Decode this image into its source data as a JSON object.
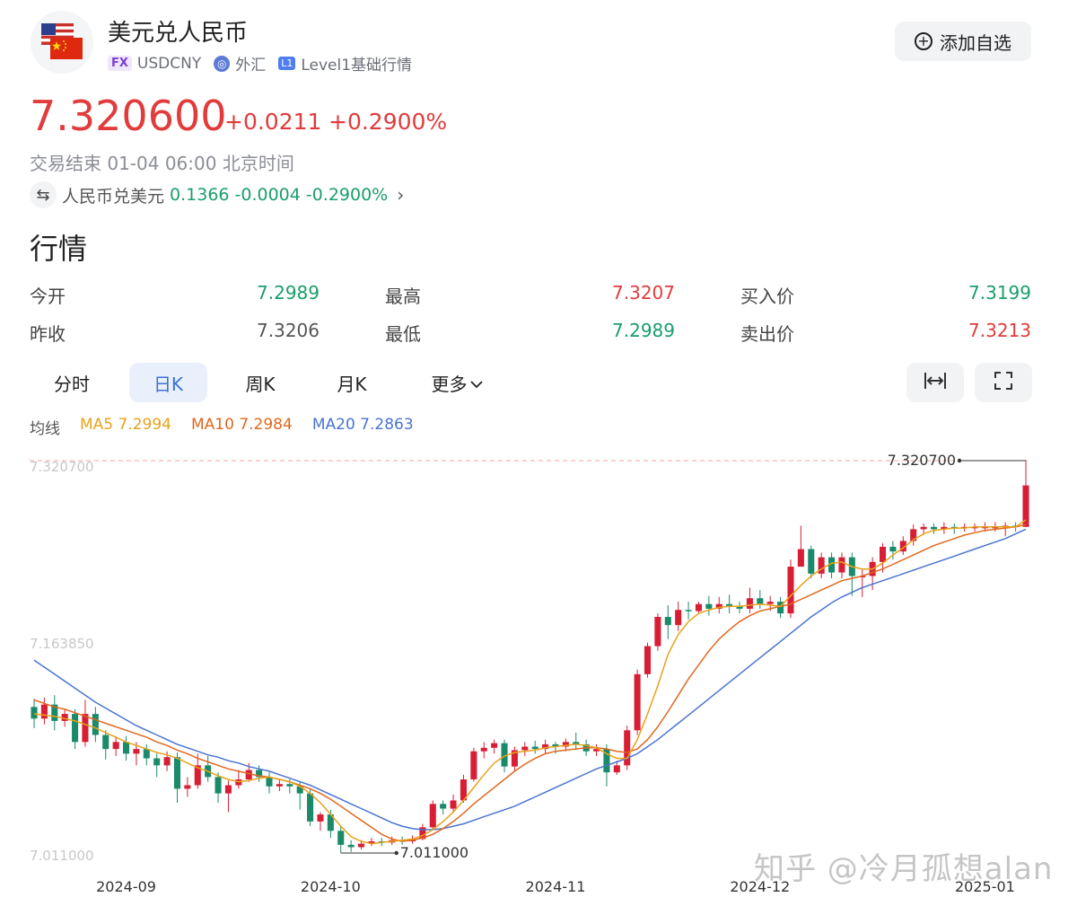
{
  "header": {
    "title": "美元兑人民币",
    "tag_fx": "FX",
    "symbol": "USDCNY",
    "market": "外汇",
    "tag_l1": "L1",
    "level": "Level1基础行情",
    "watch_label": "添加自选"
  },
  "quote": {
    "price": "7.320600",
    "change": "+0.0211",
    "change_pct": "+0.2900%",
    "session": "交易结束 01-04 06:00 北京时间",
    "inverse_label": "人民币兑美元",
    "inverse_price": "0.1366",
    "inverse_change": "-0.0004",
    "inverse_pct": "-0.2900%"
  },
  "section_title": "行情",
  "stats": {
    "open_label": "今开",
    "open": "7.2989",
    "high_label": "最高",
    "high": "7.3207",
    "bid_label": "买入价",
    "bid": "7.3199",
    "prev_close_label": "昨收",
    "prev_close": "7.3206",
    "low_label": "最低",
    "low": "7.2989",
    "ask_label": "卖出价",
    "ask": "7.3213"
  },
  "tabs": [
    "分时",
    "日K",
    "周K",
    "月K",
    "更多"
  ],
  "active_tab": "日K",
  "ma": {
    "label": "均线",
    "ma5": "MA5 7.2994",
    "ma10": "MA10 7.2984",
    "ma20": "MA20 7.2863"
  },
  "colors": {
    "up": "#d81e35",
    "down": "#1a8a6a",
    "ma5": "#e8a21a",
    "ma10": "#e0681f",
    "ma20": "#4a74d0",
    "accent": "#3a6fd8"
  },
  "watermark": "知乎 @冷月孤想alan",
  "chart_data": {
    "type": "candlestick",
    "y_range": [
      7.011,
      7.3207
    ],
    "axis_top_label": "7.320700",
    "axis_mid_label": "7.163850",
    "axis_bottom_label": "7.011000",
    "high_marker_label": "7.320700",
    "low_marker_label": "7.011000",
    "x_ticks": [
      "2024-09",
      "2024-10",
      "2024-11",
      "2024-12",
      "2025-01"
    ],
    "tick_positions": [
      9,
      29,
      51,
      71,
      93
    ],
    "candles": [
      [
        7.11,
        7.1,
        7.117,
        7.092
      ],
      [
        7.1,
        7.112,
        7.118,
        7.095
      ],
      [
        7.112,
        7.098,
        7.12,
        7.09
      ],
      [
        7.098,
        7.104,
        7.108,
        7.093
      ],
      [
        7.104,
        7.08,
        7.108,
        7.074
      ],
      [
        7.08,
        7.104,
        7.116,
        7.076
      ],
      [
        7.104,
        7.086,
        7.11,
        7.08
      ],
      [
        7.086,
        7.074,
        7.09,
        7.065
      ],
      [
        7.074,
        7.08,
        7.085,
        7.068
      ],
      [
        7.08,
        7.07,
        7.085,
        7.064
      ],
      [
        7.07,
        7.074,
        7.08,
        7.06
      ],
      [
        7.074,
        7.066,
        7.078,
        7.06
      ],
      [
        7.066,
        7.06,
        7.07,
        7.05
      ],
      [
        7.06,
        7.067,
        7.072,
        7.055
      ],
      [
        7.067,
        7.04,
        7.071,
        7.028
      ],
      [
        7.04,
        7.043,
        7.05,
        7.033
      ],
      [
        7.043,
        7.06,
        7.07,
        7.04
      ],
      [
        7.06,
        7.05,
        7.068,
        7.046
      ],
      [
        7.05,
        7.036,
        7.054,
        7.028
      ],
      [
        7.036,
        7.043,
        7.047,
        7.02
      ],
      [
        7.043,
        7.048,
        7.056,
        7.04
      ],
      [
        7.048,
        7.056,
        7.062,
        7.046
      ],
      [
        7.056,
        7.05,
        7.06,
        7.046
      ],
      [
        7.05,
        7.042,
        7.054,
        7.036
      ],
      [
        7.042,
        7.044,
        7.048,
        7.038
      ],
      [
        7.044,
        7.042,
        7.048,
        7.036
      ],
      [
        7.042,
        7.036,
        7.046,
        7.022
      ],
      [
        7.036,
        7.012,
        7.04,
        7.008
      ],
      [
        7.012,
        7.018,
        7.02,
        7.004
      ],
      [
        7.018,
        7.004,
        7.022,
        6.998
      ],
      [
        7.004,
        6.992,
        7.008,
        6.985
      ],
      [
        6.992,
        6.99,
        6.996,
        6.986
      ],
      [
        6.99,
        6.993,
        6.996,
        6.988
      ],
      [
        6.993,
        6.995,
        6.998,
        6.991
      ],
      [
        6.995,
        6.994,
        6.998,
        6.991
      ],
      [
        6.994,
        6.996,
        6.999,
        6.992
      ],
      [
        6.996,
        6.995,
        6.999,
        6.992
      ],
      [
        6.995,
        6.997,
        7.0,
        6.993
      ],
      [
        6.997,
        7.007,
        7.01,
        6.996
      ],
      [
        7.007,
        7.027,
        7.03,
        7.005
      ],
      [
        7.027,
        7.023,
        7.03,
        7.018
      ],
      [
        7.023,
        7.03,
        7.035,
        7.02
      ],
      [
        7.03,
        7.048,
        7.052,
        7.028
      ],
      [
        7.048,
        7.072,
        7.075,
        7.046
      ],
      [
        7.072,
        7.075,
        7.08,
        7.066
      ],
      [
        7.075,
        7.079,
        7.082,
        7.07
      ],
      [
        7.079,
        7.059,
        7.082,
        7.054
      ],
      [
        7.059,
        7.073,
        7.076,
        7.055
      ],
      [
        7.073,
        7.076,
        7.08,
        7.068
      ],
      [
        7.076,
        7.074,
        7.081,
        7.07
      ],
      [
        7.074,
        7.078,
        7.082,
        7.07
      ],
      [
        7.078,
        7.076,
        7.08,
        7.07
      ],
      [
        7.076,
        7.08,
        7.083,
        7.072
      ],
      [
        7.08,
        7.078,
        7.088,
        7.074
      ],
      [
        7.078,
        7.072,
        7.082,
        7.068
      ],
      [
        7.072,
        7.074,
        7.078,
        7.068
      ],
      [
        7.074,
        7.054,
        7.078,
        7.042
      ],
      [
        7.054,
        7.06,
        7.064,
        7.052
      ],
      [
        7.06,
        7.09,
        7.094,
        7.056
      ],
      [
        7.09,
        7.138,
        7.142,
        7.086
      ],
      [
        7.138,
        7.162,
        7.165,
        7.135
      ],
      [
        7.162,
        7.187,
        7.19,
        7.158
      ],
      [
        7.187,
        7.18,
        7.197,
        7.168
      ],
      [
        7.18,
        7.193,
        7.2,
        7.175
      ],
      [
        7.193,
        7.192,
        7.2,
        7.185
      ],
      [
        7.192,
        7.198,
        7.2,
        7.19
      ],
      [
        7.198,
        7.194,
        7.205,
        7.188
      ],
      [
        7.194,
        7.198,
        7.204,
        7.19
      ],
      [
        7.198,
        7.196,
        7.206,
        7.19
      ],
      [
        7.196,
        7.194,
        7.2,
        7.19
      ],
      [
        7.194,
        7.203,
        7.212,
        7.19
      ],
      [
        7.203,
        7.198,
        7.21,
        7.194
      ],
      [
        7.198,
        7.2,
        7.205,
        7.192
      ],
      [
        7.2,
        7.19,
        7.204,
        7.186
      ],
      [
        7.19,
        7.23,
        7.236,
        7.186
      ],
      [
        7.23,
        7.245,
        7.265,
        7.236
      ],
      [
        7.245,
        7.224,
        7.248,
        7.22
      ],
      [
        7.224,
        7.238,
        7.242,
        7.22
      ],
      [
        7.238,
        7.225,
        7.242,
        7.22
      ],
      [
        7.225,
        7.238,
        7.242,
        7.22
      ],
      [
        7.238,
        7.222,
        7.242,
        7.205
      ],
      [
        7.222,
        7.222,
        7.228,
        7.204
      ],
      [
        7.222,
        7.234,
        7.238,
        7.21
      ],
      [
        7.234,
        7.247,
        7.25,
        7.225
      ],
      [
        7.247,
        7.243,
        7.252,
        7.236
      ],
      [
        7.243,
        7.252,
        7.256,
        7.24
      ],
      [
        7.252,
        7.262,
        7.266,
        7.248
      ],
      [
        7.262,
        7.264,
        7.267,
        7.258
      ],
      [
        7.264,
        7.262,
        7.267,
        7.258
      ],
      [
        7.262,
        7.264,
        7.268,
        7.258
      ],
      [
        7.264,
        7.263,
        7.267,
        7.258
      ],
      [
        7.263,
        7.264,
        7.267,
        7.26
      ],
      [
        7.264,
        7.264,
        7.267,
        7.26
      ],
      [
        7.264,
        7.264,
        7.268,
        7.26
      ],
      [
        7.264,
        7.264,
        7.268,
        7.26
      ],
      [
        7.264,
        7.265,
        7.268,
        7.256
      ],
      [
        7.265,
        7.264,
        7.268,
        7.26
      ],
      [
        7.264,
        7.2995,
        7.3207,
        7.2989
      ]
    ],
    "ma5": [
      7.104,
      7.103,
      7.102,
      7.1,
      7.098,
      7.095,
      7.092,
      7.088,
      7.084,
      7.08,
      7.077,
      7.074,
      7.071,
      7.069,
      7.066,
      7.062,
      7.058,
      7.055,
      7.051,
      7.048,
      7.046,
      7.047,
      7.049,
      7.05,
      7.048,
      7.046,
      7.042,
      7.036,
      7.028,
      7.018,
      7.008,
      6.999,
      6.995,
      6.993,
      6.994,
      6.995,
      6.996,
      6.997,
      7.0,
      7.005,
      7.012,
      7.02,
      7.03,
      7.041,
      7.052,
      7.062,
      7.068,
      7.071,
      7.072,
      7.073,
      7.075,
      7.076,
      7.077,
      7.078,
      7.077,
      7.075,
      7.07,
      7.066,
      7.066,
      7.082,
      7.104,
      7.128,
      7.155,
      7.172,
      7.183,
      7.19,
      7.193,
      7.195,
      7.196,
      7.196,
      7.197,
      7.198,
      7.197,
      7.196,
      7.205,
      7.214,
      7.222,
      7.228,
      7.233,
      7.234,
      7.23,
      7.228,
      7.228,
      7.233,
      7.24,
      7.246,
      7.253,
      7.258,
      7.261,
      7.262,
      7.263,
      7.263,
      7.264,
      7.264,
      7.264,
      7.264,
      7.264,
      7.27
    ],
    "ma10": [
      7.116,
      7.113,
      7.11,
      7.108,
      7.105,
      7.102,
      7.099,
      7.096,
      7.093,
      7.09,
      7.087,
      7.084,
      7.08,
      7.077,
      7.073,
      7.07,
      7.066,
      7.063,
      7.06,
      7.057,
      7.055,
      7.053,
      7.051,
      7.05,
      7.048,
      7.046,
      7.043,
      7.04,
      7.036,
      7.031,
      7.025,
      7.019,
      7.013,
      7.007,
      7.001,
      6.997,
      6.995,
      6.996,
      6.998,
      7.001,
      7.006,
      7.012,
      7.019,
      7.027,
      7.034,
      7.041,
      7.048,
      7.055,
      7.061,
      7.066,
      7.07,
      7.072,
      7.073,
      7.074,
      7.075,
      7.075,
      7.074,
      7.072,
      7.071,
      7.074,
      7.082,
      7.093,
      7.106,
      7.12,
      7.134,
      7.146,
      7.158,
      7.168,
      7.176,
      7.183,
      7.188,
      7.192,
      7.194,
      7.196,
      7.198,
      7.202,
      7.206,
      7.21,
      7.214,
      7.218,
      7.22,
      7.222,
      7.225,
      7.228,
      7.232,
      7.236,
      7.24,
      7.244,
      7.248,
      7.251,
      7.254,
      7.257,
      7.259,
      7.261,
      7.262,
      7.263,
      7.264,
      7.266
    ],
    "ma20": [
      7.15,
      7.144,
      7.138,
      7.132,
      7.126,
      7.12,
      7.114,
      7.109,
      7.104,
      7.099,
      7.094,
      7.09,
      7.086,
      7.082,
      7.078,
      7.075,
      7.072,
      7.069,
      7.067,
      7.064,
      7.062,
      7.059,
      7.057,
      7.055,
      7.052,
      7.049,
      7.046,
      7.043,
      7.039,
      7.035,
      7.031,
      7.027,
      7.023,
      7.019,
      7.015,
      7.011,
      7.008,
      7.006,
      7.005,
      7.005,
      7.006,
      7.008,
      7.01,
      7.013,
      7.016,
      7.019,
      7.022,
      7.025,
      7.029,
      7.033,
      7.037,
      7.041,
      7.045,
      7.049,
      7.053,
      7.057,
      7.06,
      7.063,
      7.066,
      7.07,
      7.076,
      7.082,
      7.089,
      7.096,
      7.103,
      7.11,
      7.117,
      7.124,
      7.131,
      7.138,
      7.145,
      7.152,
      7.159,
      7.166,
      7.173,
      7.18,
      7.187,
      7.193,
      7.199,
      7.204,
      7.208,
      7.212,
      7.215,
      7.218,
      7.221,
      7.224,
      7.227,
      7.23,
      7.233,
      7.236,
      7.239,
      7.242,
      7.245,
      7.248,
      7.251,
      7.254,
      7.258,
      7.262
    ]
  }
}
